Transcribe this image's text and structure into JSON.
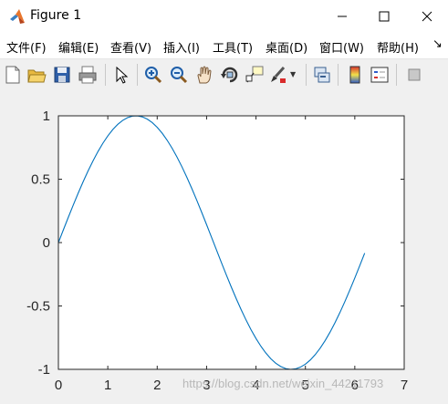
{
  "window": {
    "title": "Figure 1",
    "minimize_icon": "minimize-icon",
    "maximize_icon": "maximize-icon",
    "close_icon": "close-icon"
  },
  "menu": {
    "items": [
      "文件(F)",
      "编辑(E)",
      "查看(V)",
      "插入(I)",
      "工具(T)",
      "桌面(D)",
      "窗口(W)",
      "帮助(H)"
    ],
    "more_icon": "more-arrow-icon"
  },
  "toolbar": {
    "icons": [
      "new-figure-icon",
      "open-file-icon",
      "save-icon",
      "print-icon",
      "edit-plot-arrow-icon",
      "zoom-in-icon",
      "zoom-out-icon",
      "pan-hand-icon",
      "rotate-3d-icon",
      "data-cursor-icon",
      "brush-icon",
      "link-plot-icon",
      "insert-colorbar-icon",
      "insert-legend-icon",
      "hide-plot-tools-icon"
    ]
  },
  "chart_data": {
    "type": "line",
    "title": "",
    "xlabel": "",
    "ylabel": "",
    "xlim": [
      0,
      7
    ],
    "ylim": [
      -1,
      1
    ],
    "xticks": [
      "0",
      "1",
      "2",
      "3",
      "4",
      "5",
      "6",
      "7"
    ],
    "yticks": [
      "1",
      "0.5",
      "0",
      "-0.5",
      "-1"
    ],
    "grid": false,
    "series": [
      {
        "color": "#0072bd",
        "function": "sin(x)",
        "x_start": 0,
        "x_end": 6.2,
        "x_step": 0.1
      }
    ]
  },
  "watermark": "https://blog.csdn.net/weixin_44211793"
}
